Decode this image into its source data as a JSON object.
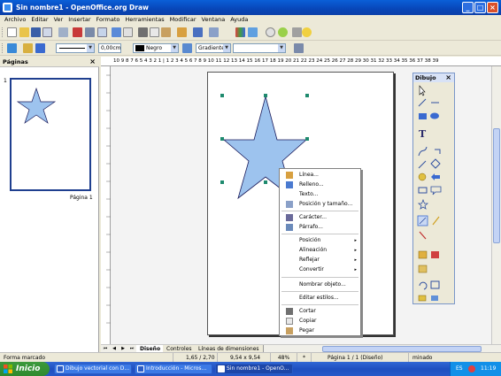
{
  "window": {
    "title": "Sin nombre1 - OpenOffice.org Draw",
    "minimize": "_",
    "maximize": "□",
    "close": "×"
  },
  "menu": [
    "Archivo",
    "Editar",
    "Ver",
    "Insertar",
    "Formato",
    "Herramientas",
    "Modificar",
    "Ventana",
    "Ayuda"
  ],
  "toolbar": {
    "line_width": "0,00cm",
    "line_color": "Negro",
    "area_style": "Gradiente",
    "area_value": ""
  },
  "pages_panel": {
    "title": "Páginas",
    "close": "×",
    "page_number": "1",
    "page_label": "Página 1"
  },
  "ruler": {
    "top": "10  9  8  7  6  5  4  3  2  1  |  1  2  3  4  5  6  7  8  9  10  11  12  13  14  15  16  17  18  19  20  21  22  23  24  25  26  27  28  29  30  31  32  33  34  35  36  37  38  39"
  },
  "tabs": [
    "Diseño",
    "Controles",
    "Líneas de dimensiones"
  ],
  "dibujo": {
    "title": "Dibujo",
    "close": "×",
    "text_tool": "T"
  },
  "context_menu": {
    "items": [
      {
        "label": "Línea...",
        "icon": "line-style-icon"
      },
      {
        "label": "Relleno...",
        "icon": "fill-icon"
      },
      {
        "label": "Texto...",
        "icon": ""
      },
      {
        "label": "Posición y tamaño...",
        "icon": "position-size-icon"
      },
      {
        "label": "Carácter...",
        "icon": "character-icon"
      },
      {
        "label": "Párrafo...",
        "icon": "paragraph-icon"
      },
      {
        "label": "Posición",
        "icon": "",
        "submenu": true
      },
      {
        "label": "Alineación",
        "icon": "",
        "submenu": true
      },
      {
        "label": "Reflejar",
        "icon": "",
        "submenu": true
      },
      {
        "label": "Convertir",
        "icon": "",
        "submenu": true
      },
      {
        "label": "Nombrar objeto...",
        "icon": ""
      },
      {
        "label": "Editar estilos...",
        "icon": ""
      },
      {
        "label": "Cortar",
        "icon": "cut-icon"
      },
      {
        "label": "Copiar",
        "icon": "copy-icon"
      },
      {
        "label": "Pegar",
        "icon": "paste-icon"
      }
    ],
    "submenu_arrow": "▸"
  },
  "status": {
    "mode": "Forma marcado",
    "position": "1,65 / 2,70",
    "size": "9,54 x 9,54",
    "zoom": "48%",
    "modified": "*",
    "page": "Página 1 / 1 (Diseño)",
    "extra": "minado"
  },
  "taskbar": {
    "start": "Inicio",
    "tasks": [
      "Dibujo vectorial con D...",
      "Introducción - Micros...",
      "Sin nombre1 - OpenO..."
    ],
    "language": "ES",
    "time": "11:19"
  },
  "colors": {
    "star_fill": "#9dc3ee",
    "star_stroke": "#1a1a5a",
    "handle": "#1e8a6e",
    "title_bar": "#0a5fd8",
    "taskbar": "#1f4fc0",
    "start_green": "#2f8a2f"
  }
}
